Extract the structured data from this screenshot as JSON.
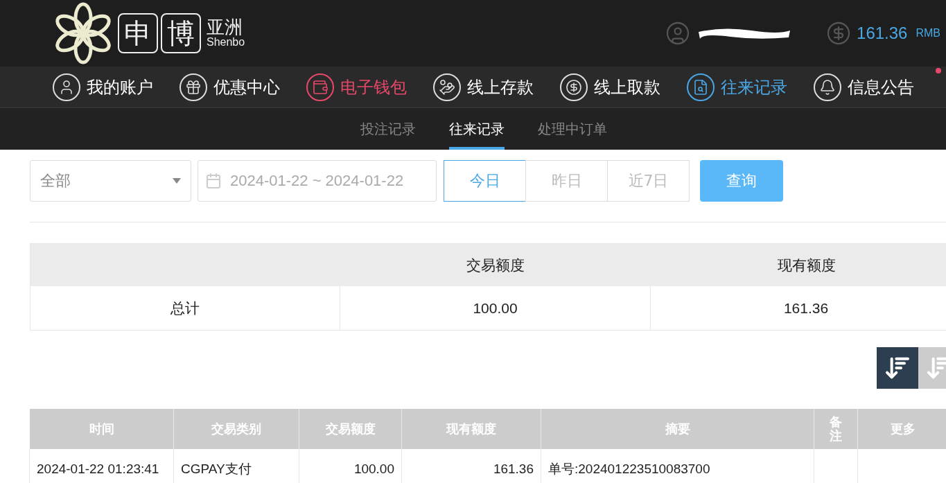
{
  "header": {
    "logo": {
      "chars": [
        "申",
        "博"
      ],
      "name": "亚洲",
      "latin": "Shenbo"
    },
    "balance": "161.36",
    "currency": "RMB"
  },
  "nav": [
    {
      "label": "我的账户",
      "color": "#ffffff",
      "dot": false
    },
    {
      "label": "优惠中心",
      "color": "#ffffff",
      "dot": false
    },
    {
      "label": "电子钱包",
      "color": "#e8486a",
      "dot": false
    },
    {
      "label": "线上存款",
      "color": "#ffffff",
      "dot": false
    },
    {
      "label": "线上取款",
      "color": "#ffffff",
      "dot": false
    },
    {
      "label": "往来记录",
      "color": "#4aa8e6",
      "dot": false
    },
    {
      "label": "信息公告",
      "color": "#ffffff",
      "dot": true
    }
  ],
  "subtabs": [
    {
      "label": "投注记录",
      "selected": false
    },
    {
      "label": "往来记录",
      "selected": true
    },
    {
      "label": "处理中订单",
      "selected": false
    }
  ],
  "filter": {
    "type": "全部",
    "date_range": "2024-01-22 ~ 2024-01-22",
    "quick": [
      {
        "label": "今日",
        "selected": true
      },
      {
        "label": "昨日",
        "selected": false
      },
      {
        "label": "近7日",
        "selected": false
      }
    ],
    "submit": "查询"
  },
  "summary": {
    "columns": [
      "",
      "交易额度",
      "现有额度"
    ],
    "rows": [
      [
        "总计",
        "100.00",
        "161.36"
      ]
    ]
  },
  "sort_buttons": [
    {
      "selected": true
    },
    {
      "selected": false
    }
  ],
  "table": {
    "columns": [
      "时间",
      "交易类别",
      "交易额度",
      "现有额度",
      "摘要",
      "备注",
      "更多"
    ],
    "rows": [
      [
        "2024-01-22 01:23:41",
        "CGPAY支付",
        "100.00",
        "161.36",
        "单号:202401223510083700",
        "",
        ""
      ]
    ]
  }
}
